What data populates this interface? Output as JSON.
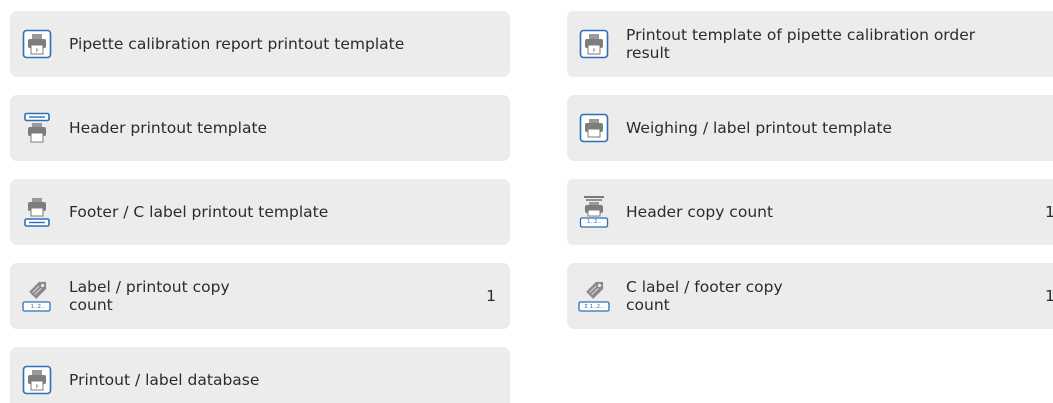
{
  "tiles": {
    "pipette_report_template": {
      "label": "Pipette calibration report printout template",
      "icon": "pipette-printer-icon"
    },
    "pipette_order_template": {
      "label": "Printout template of pipette calibration order result",
      "icon": "pipette-printer-icon"
    },
    "header_template": {
      "label": "Header printout template",
      "icon": "header-printer-icon"
    },
    "weighing_label_template": {
      "label": "Weighing / label printout template",
      "icon": "printer-icon"
    },
    "footer_template": {
      "label": "Footer / C label printout template",
      "icon": "footer-printer-icon"
    },
    "header_copy_count": {
      "label": "Header copy count",
      "value": "1",
      "icon": "header-count-icon"
    },
    "label_copy_count": {
      "label_line1": "Label / printout copy",
      "label_line2": "count",
      "value": "1",
      "icon": "label-count-icon"
    },
    "c_label_copy_count": {
      "label_line1": "C label / footer copy",
      "label_line2": "count",
      "value": "1",
      "icon": "c-label-count-icon"
    },
    "printout_label_database": {
      "label": "Printout / label database",
      "icon": "database-printer-icon"
    }
  },
  "icon_text": {
    "count_badge": "1..2..",
    "sum_badge": "Σ 1..2.."
  },
  "colors": {
    "tile_bg": "#ececec",
    "icon_blue": "#2e6fb7",
    "text": "#2b2b2b"
  }
}
